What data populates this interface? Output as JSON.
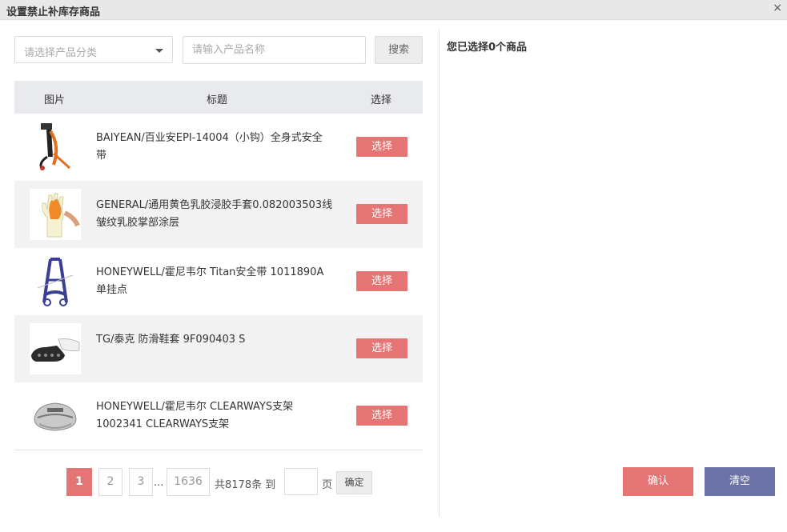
{
  "dialog": {
    "title": "设置禁止补库存商品",
    "close_glyph": "×"
  },
  "filters": {
    "category_placeholder": "请选择产品分类",
    "name_placeholder": "请输入产品名称",
    "search_label": "搜索"
  },
  "table": {
    "headers": {
      "image": "图片",
      "title": "标题",
      "select": "选择"
    },
    "rows": [
      {
        "line1": "BAIYEAN/百业安EPI-14004（小钩）全身式安全",
        "line2": "带",
        "select_label": "选择",
        "icon": "safety-belt-icon"
      },
      {
        "line1": "GENERAL/通用黄色乳胶浸胶手套0.082003503线",
        "line2": "皱纹乳胶掌部涂层",
        "select_label": "选择",
        "icon": "glove-icon"
      },
      {
        "line1": "HONEYWELL/霍尼韦尔 Titan安全带 1011890A",
        "line2": "单挂点",
        "select_label": "选择",
        "icon": "harness-icon"
      },
      {
        "line1": "TG/泰克 防滑鞋套 9F090403 S",
        "line2": "",
        "select_label": "选择",
        "icon": "shoe-cover-icon"
      },
      {
        "line1": "HONEYWELL/霍尼韦尔 CLEARWAYS支架",
        "line2": "1002341 CLEARWAYS支架",
        "select_label": "选择",
        "icon": "face-shield-bracket-icon"
      }
    ]
  },
  "pagination": {
    "pages": [
      "1",
      "2",
      "3"
    ],
    "ellipsis": "...",
    "last_page": "1636",
    "total_text": "共8178条 到",
    "page_unit": "页",
    "goto_value": "",
    "goto_label": "确定"
  },
  "selection": {
    "count_text": "您已选择0个商品"
  },
  "actions": {
    "confirm_label": "确认",
    "clear_label": "清空"
  },
  "colors": {
    "accent_red": "#e57575",
    "accent_blue": "#6b73a6",
    "header_bg": "#e9eaee"
  }
}
